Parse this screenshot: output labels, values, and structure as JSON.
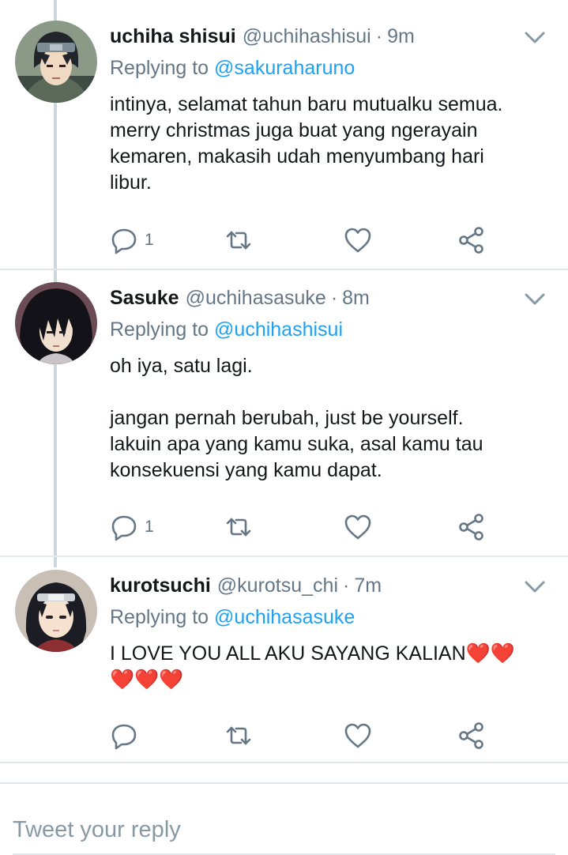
{
  "tweets": [
    {
      "name": "uchiha shisui",
      "handle": "@uchihashisui",
      "separator": "·",
      "time": "9m",
      "replying_prefix": "Replying to",
      "replying_to": "@sakuraharuno",
      "text": "intinya, selamat tahun baru mutualku semua.\nmerry christmas juga buat yang ngerayain\nkemaren, makasih udah menyumbang hari\nlibur.",
      "reply_count": "1"
    },
    {
      "name": "Sasuke",
      "handle": "@uchihasasuke",
      "separator": "·",
      "time": "8m",
      "replying_prefix": "Replying to",
      "replying_to": "@uchihashisui",
      "text": "oh iya, satu lagi.\n\njangan pernah berubah, just be yourself.\nlakuin apa yang kamu suka, asal kamu tau\nkonsekuensi yang kamu dapat.",
      "reply_count": "1"
    },
    {
      "name": "kurotsuchi",
      "handle": "@kurotsu_chi",
      "separator": "·",
      "time": "7m",
      "replying_prefix": "Replying to",
      "replying_to": "@uchihasasuke",
      "text": "I LOVE YOU ALL AKU SAYANG KALIAN❤️❤️\n❤️❤️❤️",
      "reply_count": ""
    }
  ],
  "compose": {
    "placeholder": "Tweet your reply"
  },
  "icons": {
    "reply": "reply-icon",
    "retweet": "retweet-icon",
    "like": "like-icon",
    "share": "share-icon",
    "caret": "chevron-down-icon"
  },
  "colors": {
    "text": "#14171a",
    "secondary": "#657786",
    "link": "#1da1f2",
    "icon": "#657786",
    "divider": "#e1e8ed",
    "thread_line": "#ccd6dd",
    "heart": "#e0245e"
  }
}
